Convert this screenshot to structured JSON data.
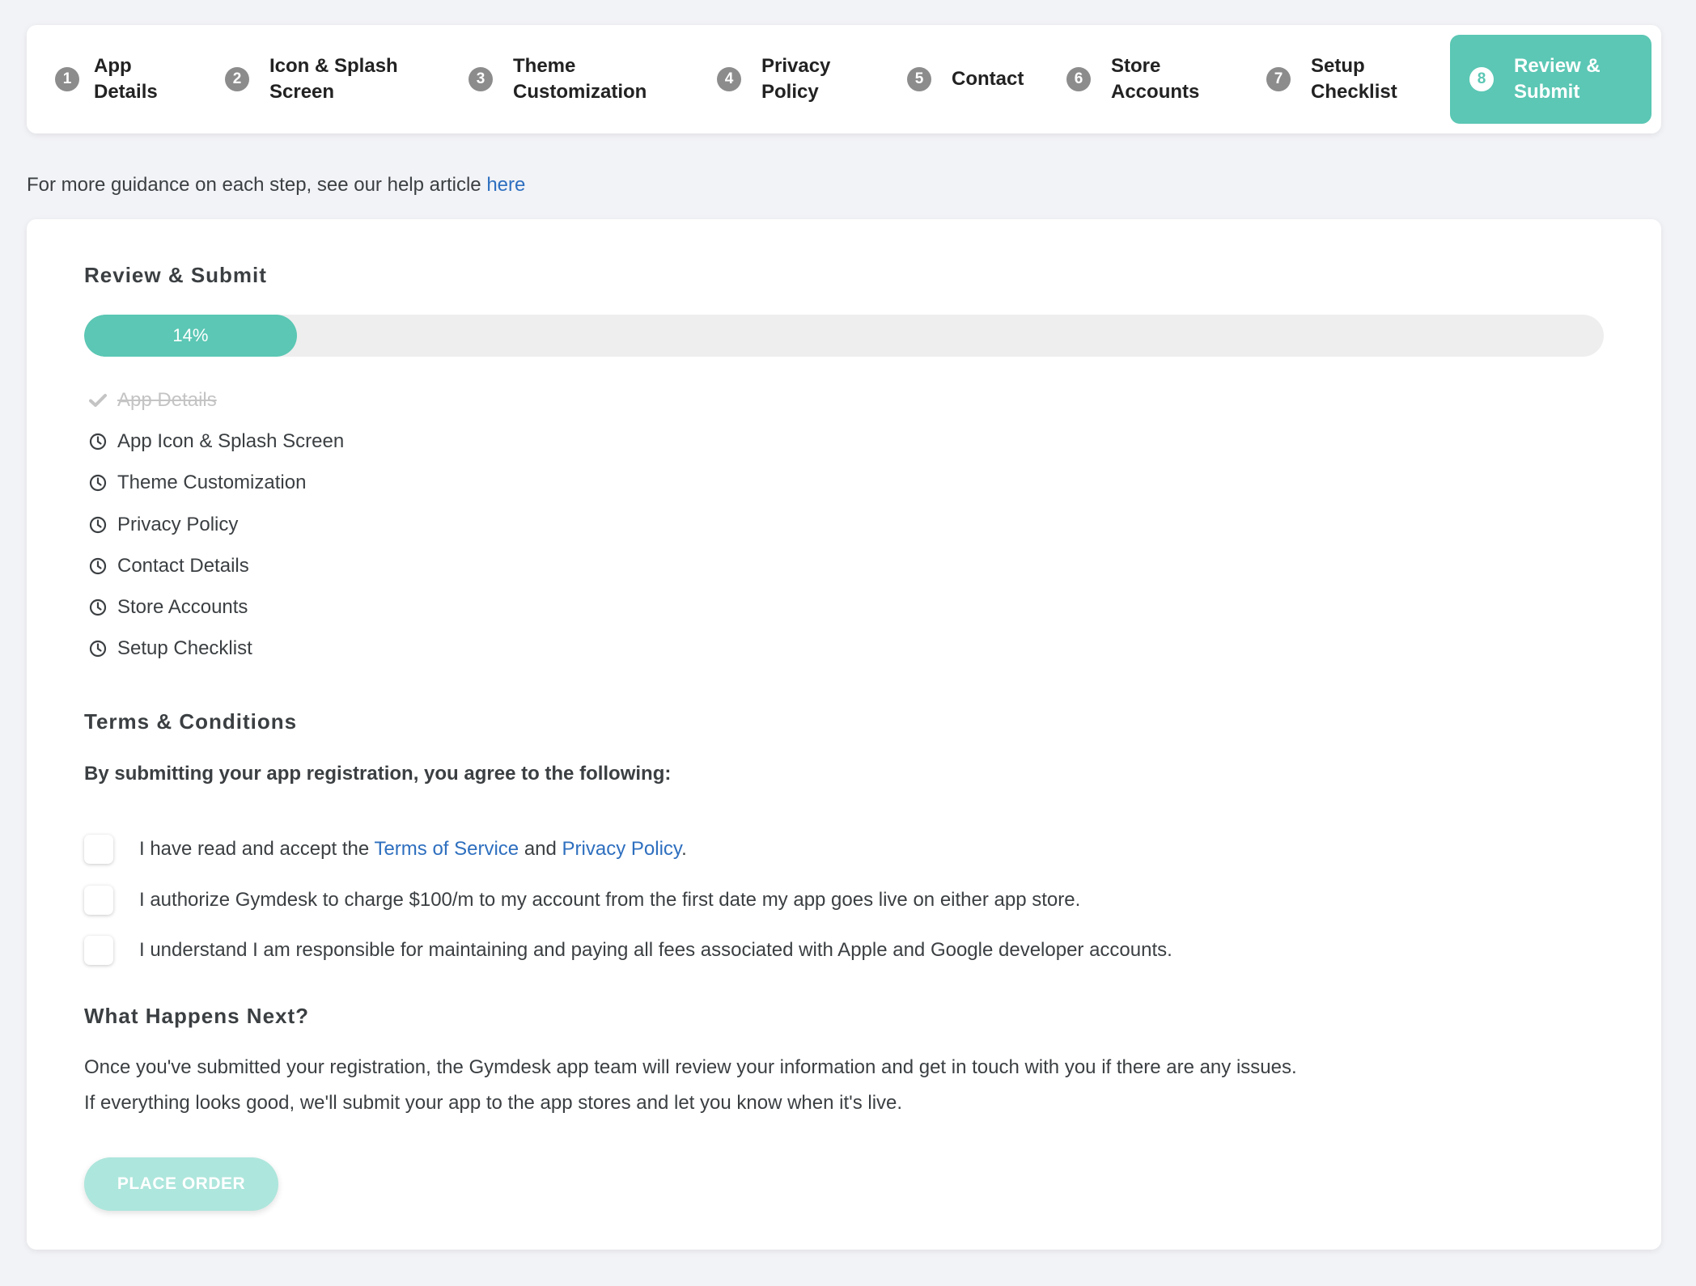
{
  "stepper": {
    "steps": [
      {
        "num": "1",
        "label": "App\nDetails"
      },
      {
        "num": "2",
        "label": "Icon & Splash\nScreen"
      },
      {
        "num": "3",
        "label": "Theme\nCustomization"
      },
      {
        "num": "4",
        "label": "Privacy\nPolicy"
      },
      {
        "num": "5",
        "label": "Contact"
      },
      {
        "num": "6",
        "label": "Store\nAccounts"
      },
      {
        "num": "7",
        "label": "Setup\nChecklist"
      },
      {
        "num": "8",
        "label": "Review &\nSubmit"
      }
    ],
    "active_step": "8"
  },
  "help": {
    "text": "For more guidance on each step, see our help article ",
    "link": "here"
  },
  "review": {
    "title": "Review & Submit",
    "progress_percent": 14,
    "progress_label": "14%",
    "items": [
      {
        "label": "App Details",
        "status": "done"
      },
      {
        "label": "App Icon & Splash Screen",
        "status": "pending"
      },
      {
        "label": "Theme Customization",
        "status": "pending"
      },
      {
        "label": "Privacy Policy",
        "status": "pending"
      },
      {
        "label": "Contact Details",
        "status": "pending"
      },
      {
        "label": "Store Accounts",
        "status": "pending"
      },
      {
        "label": "Setup Checklist",
        "status": "pending"
      }
    ]
  },
  "terms": {
    "title": "Terms & Conditions",
    "intro": "By submitting your app registration, you agree to the following:",
    "t1_pre": "I have read and accept the ",
    "t1_tos": "Terms of Service",
    "t1_and": " and ",
    "t1_pp": "Privacy Policy",
    "t1_end": ".",
    "t2": "I authorize Gymdesk to charge $100/m to my account from the first date my app goes live on either app store.",
    "t3": "I understand I am responsible for maintaining and paying all fees associated with Apple and Google developer accounts."
  },
  "next": {
    "title": "What Happens Next?",
    "p1": "Once you've submitted your registration, the Gymdesk app team will review your information and get in touch with you if there are any issues.",
    "p2": "If everything looks good, we'll submit your app to the app stores and let you know when it's live."
  },
  "button": {
    "label": "PLACE ORDER"
  },
  "colors": {
    "accent": "#5bc7b4",
    "accent_disabled": "#ade6dc",
    "link": "#2e6fbf",
    "step_inactive": "#8c8c8c"
  },
  "icons": {
    "done": "check-icon",
    "pending": "clock-icon"
  }
}
